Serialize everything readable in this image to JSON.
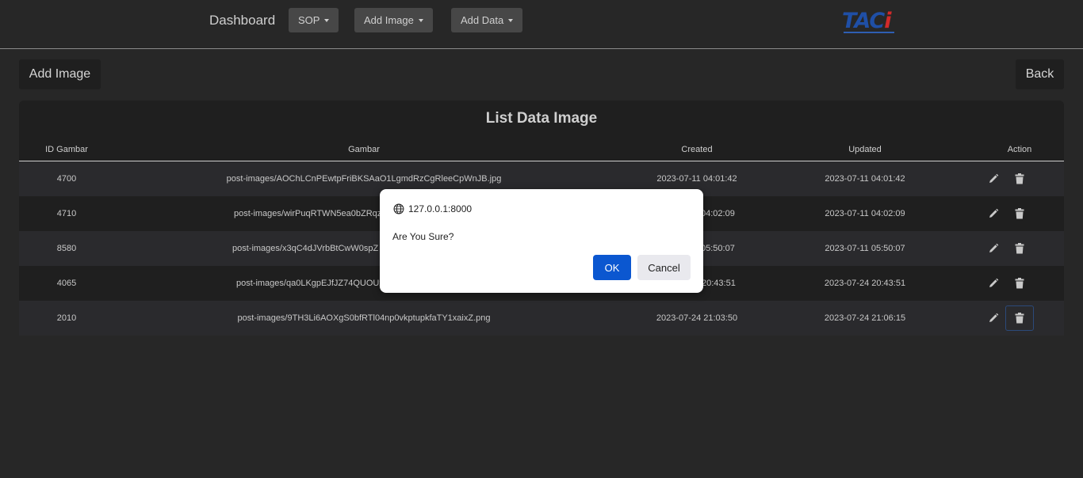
{
  "nav": {
    "brand": "Dashboard",
    "menus": [
      {
        "label": "SOP"
      },
      {
        "label": "Add Image"
      },
      {
        "label": "Add Data"
      }
    ],
    "logo_text": "TACi",
    "logo_colors": {
      "blue": "#1f4fa6",
      "red": "#d12a2a"
    }
  },
  "toolbar": {
    "add_label": "Add Image",
    "back_label": "Back"
  },
  "table": {
    "title": "List Data Image",
    "columns": [
      "ID Gambar",
      "Gambar",
      "Created",
      "Updated",
      "Action"
    ],
    "rows": [
      {
        "id": "4700",
        "gambar": "post-images/AOChLCnPEwtpFriBKSAaO1LgmdRzCgRleeCpWnJB.jpg",
        "created": "2023-07-11 04:01:42",
        "updated": "2023-07-11 04:01:42"
      },
      {
        "id": "4710",
        "gambar": "post-images/wirPuqRTWN5ea0bZRqz",
        "created": "04:02:09",
        "updated": "2023-07-11 04:02:09"
      },
      {
        "id": "8580",
        "gambar": "post-images/x3qC4dJVrbBtCwW0spZ",
        "created": "05:50:07",
        "updated": "2023-07-11 05:50:07"
      },
      {
        "id": "4065",
        "gambar": "post-images/qa0LKgpEJfJZ74QUOUx",
        "created": "20:43:51",
        "updated": "2023-07-24 20:43:51"
      },
      {
        "id": "2010",
        "gambar": "post-images/9TH3Li6AOXgS0bfRTl04np0vkptupkfaTY1xaixZ.png",
        "created": "2023-07-24 21:03:50",
        "updated": "2023-07-24 21:06:15"
      }
    ],
    "action_icons": [
      "pencil-icon",
      "trash-icon"
    ]
  },
  "dialog": {
    "origin": "127.0.0.1:8000",
    "message": "Are You Sure?",
    "ok_label": "OK",
    "cancel_label": "Cancel",
    "accent": "#0b57d0"
  }
}
